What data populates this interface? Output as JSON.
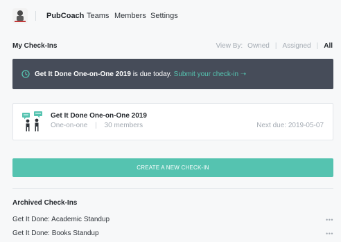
{
  "nav": {
    "brand": "PubCoach",
    "links": [
      "Teams",
      "Members",
      "Settings"
    ]
  },
  "checkins": {
    "title": "My Check-Ins",
    "view_by_label": "View By:",
    "view_options": [
      "Owned",
      "Assigned",
      "All"
    ],
    "active_view": "All"
  },
  "banner": {
    "icon": "clock-icon",
    "name": "Get It Done One-on-One 2019",
    "suffix": " is due today.",
    "link": "Submit your check-in ➝"
  },
  "card": {
    "icon": "one-on-one-icon",
    "title": "Get It Done One-on-One 2019",
    "type": "One-on-one",
    "members": "30 members",
    "next_due": "Next due: 2019-05-07"
  },
  "create_button": "CREATE A NEW CHECK-IN",
  "archived": {
    "title": "Archived Check-Ins",
    "items": [
      "Get It Done: Academic Standup",
      "Get It Done: Books Standup"
    ],
    "more_icon": "•••"
  },
  "colors": {
    "accent": "#55c3b0",
    "banner_bg": "#464c59",
    "muted_text": "#a4abb3"
  }
}
